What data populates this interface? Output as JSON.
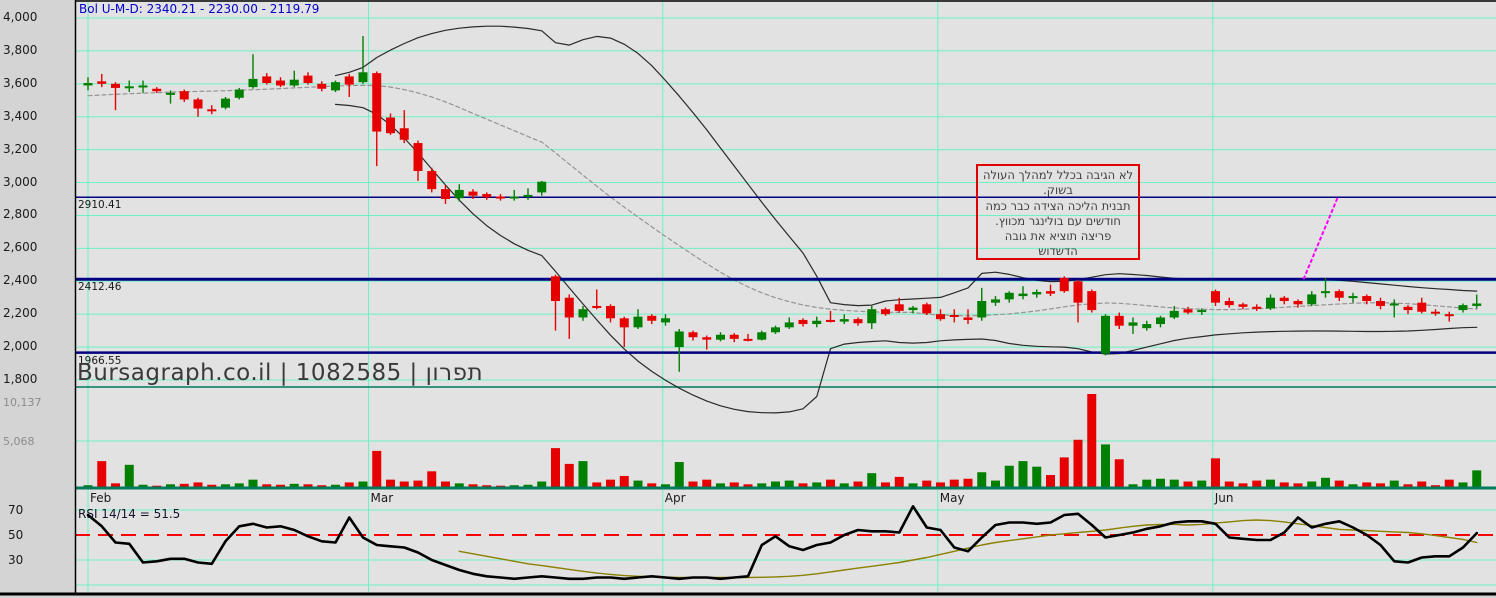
{
  "header": {
    "indicator_label": "Bol U-M-D: 2340.21 - 2230.00 - 2119.79"
  },
  "watermark": "Bursagraph.co.il | 1082585 | תפרון",
  "rsi_title": "RSI 14/14 = 51.5",
  "annotation": {
    "border_color": "#e00000",
    "lines": [
      "לא הגיבה בכלל למהלך העולה",
      "בשוק.",
      "תבנית הליכה הצידה כבר כמה",
      "חודשים עם בולינגר מכווץ.",
      "פריצה תוציא את גובה",
      "הדשדוש"
    ]
  },
  "axes": {
    "price_ticks": [
      {
        "label": "4,000",
        "value": 4000
      },
      {
        "label": "3,800",
        "value": 3800
      },
      {
        "label": "3,600",
        "value": 3600
      },
      {
        "label": "3,400",
        "value": 3400
      },
      {
        "label": "3,200",
        "value": 3200
      },
      {
        "label": "3,000",
        "value": 3000
      },
      {
        "label": "2,800",
        "value": 2800
      },
      {
        "label": "2,600",
        "value": 2600
      },
      {
        "label": "2,400",
        "value": 2400
      },
      {
        "label": "2,200",
        "value": 2200
      },
      {
        "label": "2,000",
        "value": 2000
      },
      {
        "label": "1,800",
        "value": 1800
      }
    ],
    "volume_ticks": [
      {
        "label": "10,137",
        "value": 10137
      },
      {
        "label": "5,068",
        "value": 5068
      }
    ],
    "rsi_ticks": [
      {
        "label": "70",
        "value": 70
      },
      {
        "label": "50",
        "value": 50
      },
      {
        "label": "30",
        "value": 30
      }
    ],
    "months": [
      {
        "label": "Feb",
        "idx": 0
      },
      {
        "label": "Mar",
        "idx": 20.4
      },
      {
        "label": "Apr",
        "idx": 41.8
      },
      {
        "label": "May",
        "idx": 61.8
      },
      {
        "label": "Jun",
        "idx": 81.8
      }
    ]
  },
  "hlines": [
    {
      "label": "2910.41",
      "value": 2910.41,
      "weight": 1.5
    },
    {
      "label": "2412.46",
      "value": 2412.46,
      "weight": 3
    },
    {
      "label": "1966.55",
      "value": 1966.55,
      "weight": 2.5
    }
  ],
  "colors": {
    "plot_bg": "#e2e2e2",
    "margin_bg": "#d4d4d4",
    "grid": "#6ef2c4",
    "separator": "#00795c",
    "hline": "#000080",
    "up": "#008000",
    "down": "#e60000",
    "band": "#2a2a2a",
    "band_mid": "#949494",
    "rsi_line": "#000000",
    "rsi_ma": "#8b8000",
    "rsi_mid": "#ff0000",
    "trendline": "#ff00ff",
    "label_blue": "#0000c8"
  },
  "chart_data": {
    "type": "candlestick",
    "panes": [
      "price",
      "volume",
      "rsi"
    ],
    "x_tick_labels": [
      "Feb",
      "Mar",
      "Apr",
      "May",
      "Jun"
    ],
    "price_range": [
      1800,
      4000
    ],
    "rsi_levels": [
      70,
      50,
      30,
      10
    ],
    "candles": [
      [
        3590,
        3640,
        3560,
        3605
      ],
      [
        3615,
        3660,
        3580,
        3600
      ],
      [
        3600,
        3610,
        3440,
        3575
      ],
      [
        3575,
        3620,
        3550,
        3585
      ],
      [
        3580,
        3620,
        3545,
        3590
      ],
      [
        3570,
        3580,
        3545,
        3555
      ],
      [
        3535,
        3560,
        3480,
        3545
      ],
      [
        3555,
        3565,
        3490,
        3505
      ],
      [
        3505,
        3515,
        3400,
        3450
      ],
      [
        3445,
        3470,
        3415,
        3435
      ],
      [
        3455,
        3520,
        3445,
        3510
      ],
      [
        3515,
        3575,
        3505,
        3565
      ],
      [
        3580,
        3780,
        3570,
        3630
      ],
      [
        3645,
        3665,
        3595,
        3605
      ],
      [
        3620,
        3640,
        3580,
        3590
      ],
      [
        3590,
        3680,
        3580,
        3625
      ],
      [
        3650,
        3670,
        3595,
        3605
      ],
      [
        3600,
        3615,
        3555,
        3570
      ],
      [
        3560,
        3620,
        3550,
        3610
      ],
      [
        3645,
        3660,
        3520,
        3595
      ],
      [
        3610,
        3890,
        3600,
        3670
      ],
      [
        3665,
        3675,
        3100,
        3310
      ],
      [
        3395,
        3420,
        3290,
        3300
      ],
      [
        3330,
        3440,
        3240,
        3260
      ],
      [
        3240,
        3255,
        3010,
        3070
      ],
      [
        3070,
        3090,
        2940,
        2960
      ],
      [
        2960,
        2985,
        2870,
        2900
      ],
      [
        2905,
        2990,
        2885,
        2955
      ],
      [
        2945,
        2960,
        2900,
        2920
      ],
      [
        2930,
        2940,
        2895,
        2910
      ],
      [
        2915,
        2930,
        2890,
        2905
      ],
      [
        2905,
        2955,
        2890,
        2915
      ],
      [
        2915,
        2965,
        2895,
        2925
      ],
      [
        2940,
        3010,
        2920,
        3005
      ],
      [
        2430,
        2440,
        2100,
        2280
      ],
      [
        2300,
        2320,
        2050,
        2180
      ],
      [
        2180,
        2250,
        2160,
        2230
      ],
      [
        2250,
        2350,
        2230,
        2240
      ],
      [
        2250,
        2260,
        2150,
        2175
      ],
      [
        2175,
        2185,
        2000,
        2120
      ],
      [
        2120,
        2230,
        2110,
        2185
      ],
      [
        2190,
        2200,
        2140,
        2160
      ],
      [
        2150,
        2200,
        2130,
        2175
      ],
      [
        2000,
        2110,
        1850,
        2095
      ],
      [
        2090,
        2100,
        2040,
        2060
      ],
      [
        2060,
        2070,
        1985,
        2045
      ],
      [
        2045,
        2090,
        2035,
        2075
      ],
      [
        2075,
        2085,
        2030,
        2050
      ],
      [
        2050,
        2080,
        2035,
        2045
      ],
      [
        2045,
        2100,
        2040,
        2090
      ],
      [
        2090,
        2130,
        2080,
        2120
      ],
      [
        2120,
        2180,
        2110,
        2150
      ],
      [
        2165,
        2175,
        2125,
        2140
      ],
      [
        2140,
        2185,
        2120,
        2160
      ],
      [
        2165,
        2220,
        2150,
        2155
      ],
      [
        2155,
        2200,
        2140,
        2170
      ],
      [
        2170,
        2180,
        2130,
        2145
      ],
      [
        2145,
        2250,
        2110,
        2230
      ],
      [
        2230,
        2240,
        2190,
        2200
      ],
      [
        2260,
        2300,
        2210,
        2220
      ],
      [
        2225,
        2250,
        2205,
        2240
      ],
      [
        2260,
        2270,
        2195,
        2205
      ],
      [
        2200,
        2230,
        2160,
        2170
      ],
      [
        2195,
        2230,
        2150,
        2185
      ],
      [
        2180,
        2230,
        2140,
        2165
      ],
      [
        2180,
        2360,
        2160,
        2280
      ],
      [
        2270,
        2310,
        2250,
        2290
      ],
      [
        2290,
        2340,
        2270,
        2330
      ],
      [
        2310,
        2370,
        2290,
        2325
      ],
      [
        2320,
        2350,
        2300,
        2335
      ],
      [
        2340,
        2380,
        2310,
        2325
      ],
      [
        2420,
        2430,
        2330,
        2340
      ],
      [
        2400,
        2410,
        2150,
        2270
      ],
      [
        2340,
        2350,
        2210,
        2225
      ],
      [
        1960,
        2200,
        1950,
        2190
      ],
      [
        2190,
        2210,
        2110,
        2130
      ],
      [
        2130,
        2180,
        2080,
        2150
      ],
      [
        2115,
        2160,
        2100,
        2140
      ],
      [
        2140,
        2190,
        2120,
        2180
      ],
      [
        2180,
        2250,
        2170,
        2220
      ],
      [
        2230,
        2245,
        2200,
        2210
      ],
      [
        2215,
        2235,
        2195,
        2225
      ],
      [
        2340,
        2350,
        2250,
        2270
      ],
      [
        2280,
        2300,
        2240,
        2255
      ],
      [
        2260,
        2270,
        2230,
        2245
      ],
      [
        2245,
        2260,
        2220,
        2235
      ],
      [
        2235,
        2320,
        2225,
        2300
      ],
      [
        2300,
        2310,
        2260,
        2280
      ],
      [
        2280,
        2290,
        2240,
        2260
      ],
      [
        2260,
        2340,
        2250,
        2320
      ],
      [
        2330,
        2420,
        2300,
        2340
      ],
      [
        2340,
        2350,
        2280,
        2300
      ],
      [
        2300,
        2330,
        2270,
        2310
      ],
      [
        2310,
        2320,
        2260,
        2280
      ],
      [
        2280,
        2300,
        2230,
        2250
      ],
      [
        2255,
        2290,
        2180,
        2265
      ],
      [
        2245,
        2255,
        2200,
        2225
      ],
      [
        2270,
        2300,
        2205,
        2215
      ],
      [
        2215,
        2230,
        2190,
        2205
      ],
      [
        2200,
        2215,
        2155,
        2195
      ],
      [
        2225,
        2265,
        2210,
        2255
      ],
      [
        2250,
        2320,
        2235,
        2265
      ]
    ],
    "volume": [
      300,
      2900,
      500,
      2500,
      350,
      250,
      400,
      450,
      600,
      350,
      400,
      500,
      900,
      400,
      350,
      450,
      400,
      300,
      350,
      600,
      700,
      4000,
      900,
      700,
      800,
      1800,
      700,
      500,
      400,
      300,
      250,
      300,
      350,
      700,
      4300,
      2600,
      2900,
      600,
      900,
      1300,
      800,
      500,
      400,
      2800,
      700,
      900,
      500,
      600,
      400,
      500,
      700,
      800,
      500,
      600,
      900,
      500,
      700,
      1600,
      600,
      1200,
      500,
      800,
      600,
      900,
      1000,
      1700,
      800,
      2400,
      2900,
      2300,
      1400,
      3300,
      5200,
      10137,
      4700,
      3100,
      400,
      900,
      1000,
      900,
      700,
      800,
      3200,
      700,
      500,
      800,
      900,
      600,
      500,
      700,
      1100,
      800,
      400,
      600,
      500,
      800,
      400,
      700,
      300,
      900,
      600,
      1900
    ],
    "volume_max": 10137,
    "bollinger": {
      "last_values": {
        "upper": 2340.21,
        "middle": 2230.0,
        "lower": 2119.79
      },
      "upper": [
        null,
        null,
        null,
        null,
        null,
        null,
        null,
        null,
        null,
        null,
        null,
        null,
        null,
        null,
        null,
        null,
        null,
        null,
        3650,
        3670,
        3700,
        3760,
        3805,
        3845,
        3880,
        3905,
        3925,
        3938,
        3946,
        3950,
        3950,
        3945,
        3936,
        3922,
        3850,
        3835,
        3868,
        3888,
        3878,
        3840,
        3785,
        3710,
        3620,
        3525,
        3425,
        3320,
        3210,
        3100,
        2990,
        2880,
        2775,
        2672,
        2572,
        2430,
        2270,
        2258,
        2252,
        2255,
        2280,
        2288,
        2292,
        2297,
        2302,
        2330,
        2360,
        2448,
        2455,
        2442,
        2422,
        2406,
        2398,
        2400,
        2410,
        2425,
        2440,
        2446,
        2441,
        2435,
        2426,
        2418,
        2414,
        2412,
        2412,
        2412,
        2412,
        2412,
        2412,
        2412,
        2412,
        2412,
        2410,
        2406,
        2400,
        2392,
        2384,
        2376,
        2368,
        2361,
        2355,
        2350,
        2344,
        2340
      ],
      "middle": [
        3528,
        3532,
        3536,
        3540,
        3543,
        3546,
        3549,
        3552,
        3554,
        3556,
        3558,
        3561,
        3564,
        3567,
        3571,
        3575,
        3579,
        3583,
        3586,
        3589,
        3591,
        3589,
        3580,
        3565,
        3545,
        3520,
        3490,
        3456,
        3420,
        3385,
        3350,
        3315,
        3280,
        3246,
        3180,
        3112,
        3045,
        2978,
        2912,
        2850,
        2790,
        2731,
        2673,
        2616,
        2560,
        2506,
        2455,
        2408,
        2366,
        2330,
        2300,
        2276,
        2256,
        2241,
        2230,
        2223,
        2218,
        2214,
        2212,
        2211,
        2211,
        2200,
        2195,
        2192,
        2190,
        2192,
        2196,
        2202,
        2210,
        2220,
        2232,
        2245,
        2256,
        2264,
        2268,
        2266,
        2260,
        2252,
        2244,
        2238,
        2233,
        2230,
        2228,
        2228,
        2230,
        2233,
        2237,
        2242,
        2247,
        2252,
        2257,
        2262,
        2266,
        2269,
        2270,
        2268,
        2264,
        2258,
        2251,
        2244,
        2237,
        2231
      ],
      "lower": [
        null,
        null,
        null,
        null,
        null,
        null,
        null,
        null,
        null,
        null,
        null,
        null,
        null,
        null,
        null,
        null,
        null,
        null,
        3475,
        3468,
        3455,
        3415,
        3350,
        3270,
        3180,
        3082,
        2985,
        2893,
        2810,
        2738,
        2678,
        2628,
        2588,
        2556,
        2460,
        2360,
        2262,
        2165,
        2072,
        1988,
        1915,
        1852,
        1798,
        1750,
        1708,
        1672,
        1643,
        1622,
        1608,
        1601,
        1600,
        1606,
        1625,
        1700,
        1990,
        2018,
        2028,
        2034,
        2038,
        2028,
        2024,
        2028,
        2038,
        2044,
        2047,
        2049,
        2040,
        2022,
        2011,
        2005,
        2002,
        2000,
        1990,
        1970,
        1958,
        1961,
        1980,
        2000,
        2020,
        2040,
        2054,
        2064,
        2074,
        2081,
        2087,
        2091,
        2094,
        2096,
        2097,
        2098,
        2098,
        2097,
        2096,
        2095,
        2095,
        2096,
        2098,
        2102,
        2107,
        2113,
        2118,
        2120
      ]
    },
    "rsi": {
      "label": "RSI 14/14 = 51.5",
      "last": 51.5,
      "values": [
        66,
        57,
        44,
        43,
        28,
        29,
        31,
        31,
        28,
        27,
        45,
        57,
        59,
        56,
        57,
        54,
        49,
        45,
        44,
        64,
        48,
        42,
        41,
        40,
        36,
        30,
        26,
        22,
        19,
        17,
        16,
        15,
        16,
        17,
        16,
        15,
        15,
        16,
        16,
        15,
        16,
        17,
        16,
        15,
        16,
        16,
        15,
        16,
        17,
        42,
        49,
        41,
        38,
        42,
        44,
        50,
        54,
        53,
        53,
        52,
        73,
        56,
        54,
        40,
        37,
        48,
        58,
        60,
        60,
        59,
        60,
        66,
        67,
        58,
        48,
        50,
        52,
        55,
        57,
        60,
        61,
        61,
        59,
        48,
        47,
        46,
        46,
        52,
        64,
        56,
        59,
        61,
        56,
        50,
        42,
        29,
        28,
        32,
        33,
        33,
        40,
        51.5
      ],
      "ma": [
        null,
        null,
        null,
        null,
        null,
        null,
        null,
        null,
        null,
        null,
        null,
        null,
        null,
        null,
        null,
        null,
        null,
        null,
        null,
        null,
        null,
        null,
        null,
        null,
        null,
        null,
        null,
        37,
        35,
        33,
        31,
        29,
        27,
        25.5,
        24,
        22.5,
        21,
        19.5,
        18.5,
        17.5,
        17,
        16.6,
        16.3,
        16.1,
        16,
        16,
        16,
        16,
        16,
        16.2,
        16.5,
        17,
        17.8,
        19,
        20.5,
        22,
        23.5,
        25,
        26.5,
        28,
        30,
        32,
        34.5,
        37,
        39.5,
        42,
        44,
        45.5,
        47,
        48.5,
        50,
        51,
        52,
        53,
        54,
        55.5,
        57,
        58,
        58.5,
        58.5,
        58,
        58.5,
        59.5,
        60.5,
        61.5,
        62,
        61.5,
        60.5,
        59,
        57.5,
        56,
        54.5,
        54,
        53.5,
        53,
        52.5,
        52,
        51,
        49.5,
        48,
        46.5,
        44
      ]
    },
    "trendline": {
      "from": {
        "idx": 88.4,
        "price": 2412
      },
      "to": {
        "idx": 90.9,
        "price": 2912
      }
    }
  }
}
